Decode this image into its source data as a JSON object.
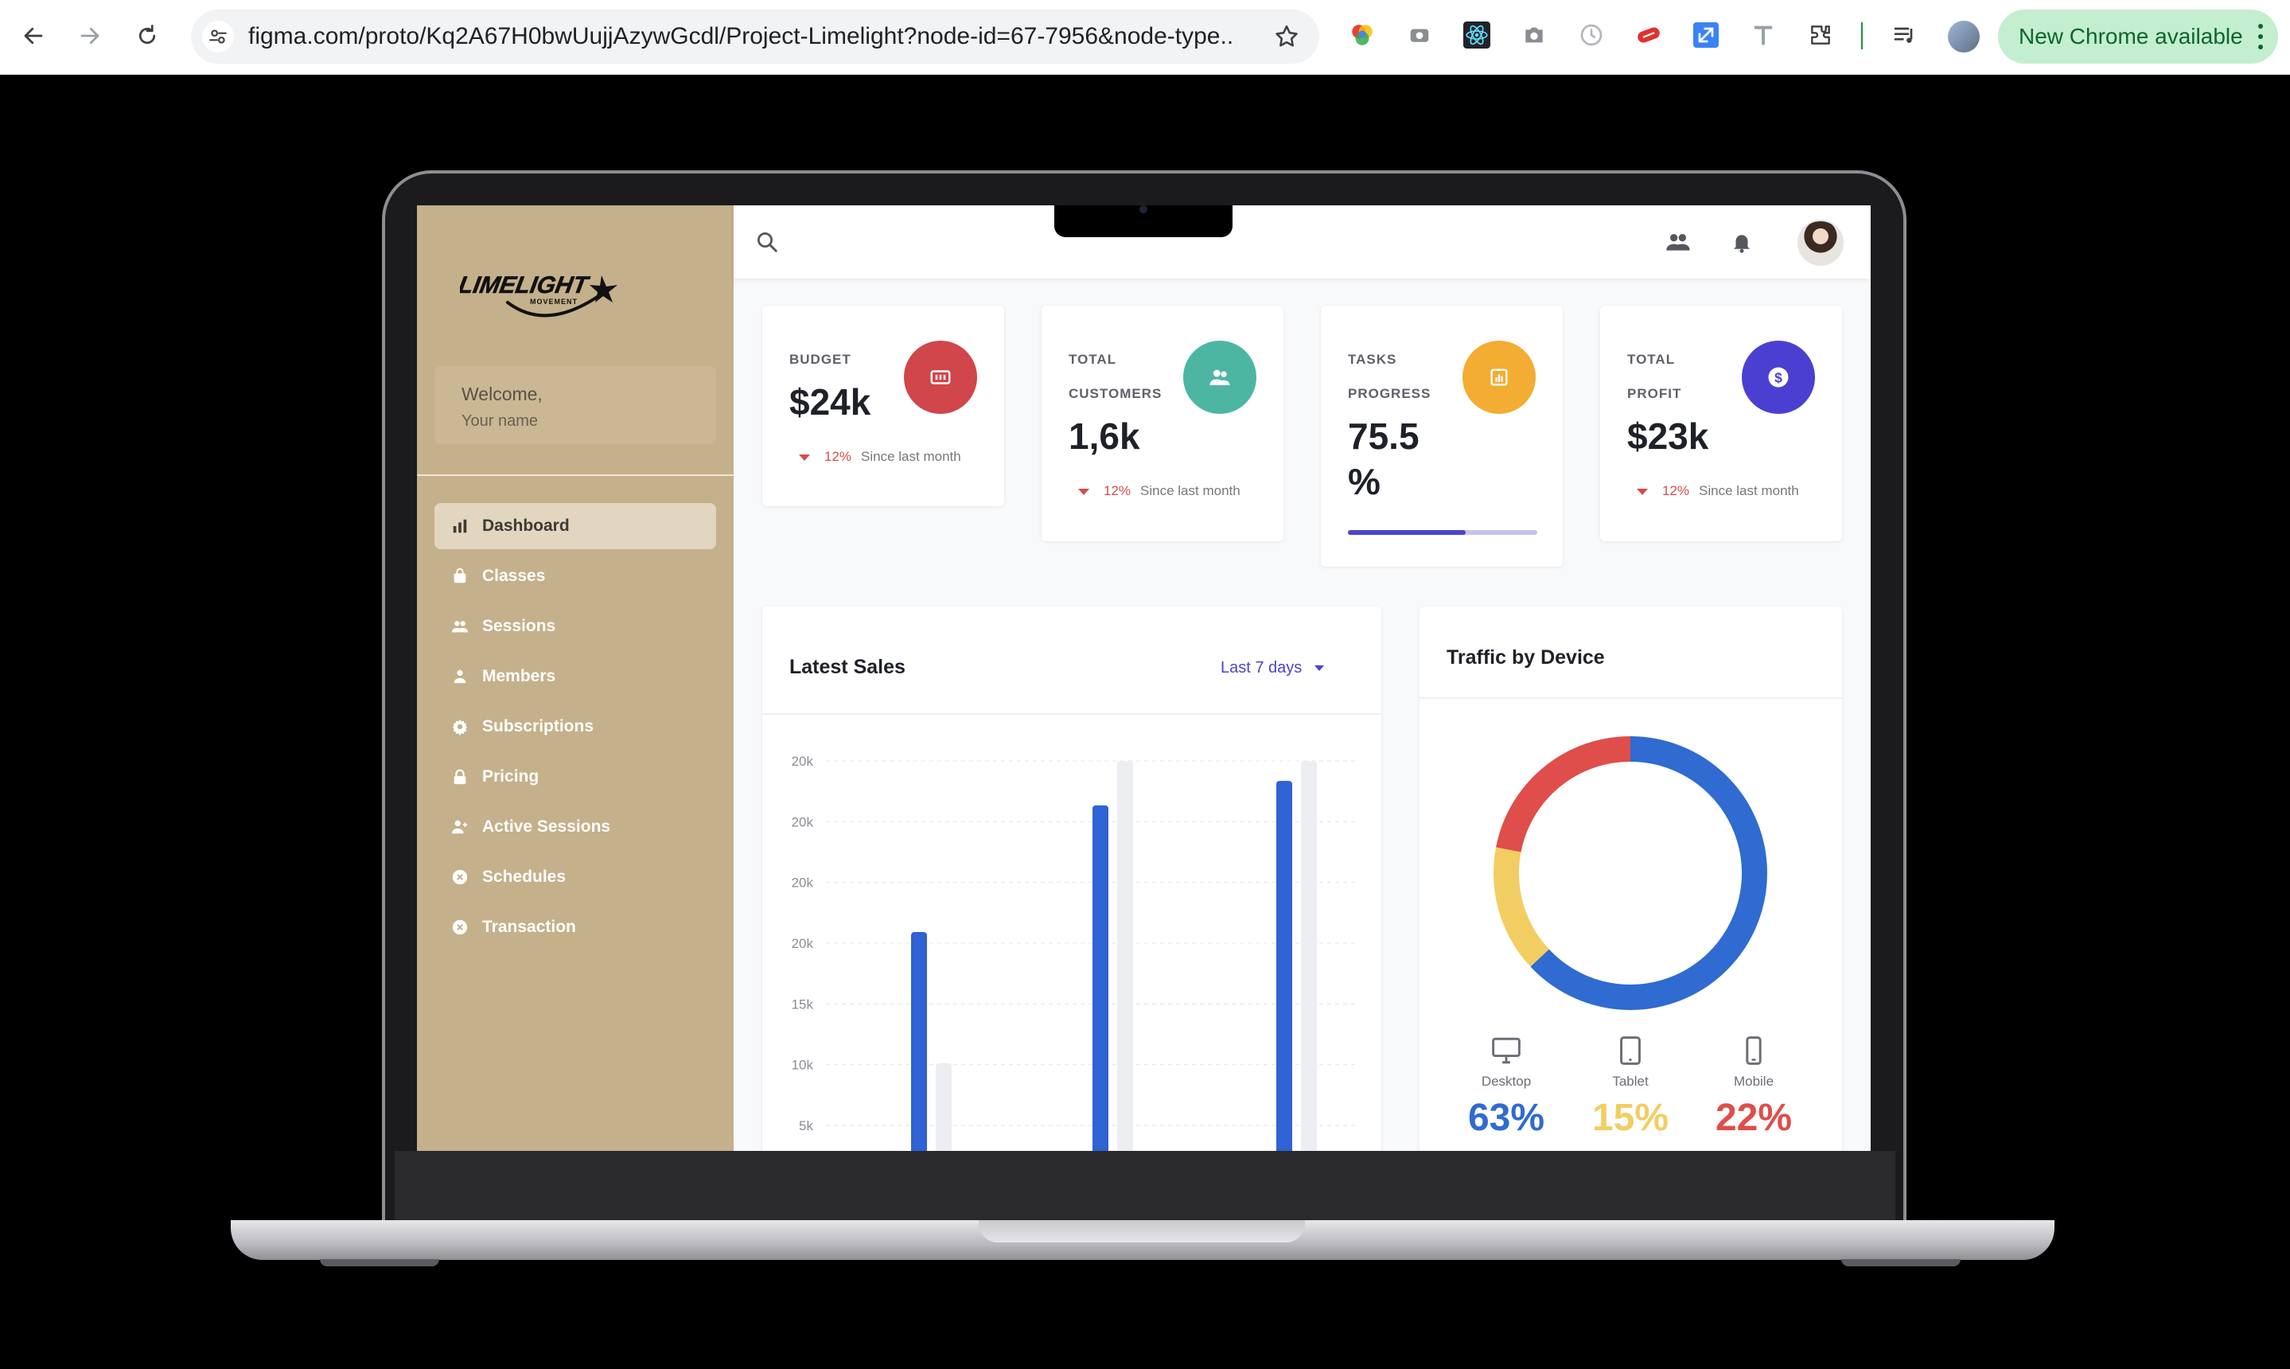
{
  "browser": {
    "url": "figma.com/proto/Kq2A67H0bwUujjAzywGcdl/Project-Limelight?node-id=67-7956&node-type...",
    "update_label": "New Chrome available"
  },
  "sidebar": {
    "brand": "LIMELIGHT",
    "brand_sub": "MOVEMENT",
    "welcome": "Welcome,",
    "user_name": "Your name",
    "items": [
      {
        "label": "Dashboard",
        "icon": "bar-chart-icon",
        "active": true
      },
      {
        "label": "Classes",
        "icon": "bag-icon"
      },
      {
        "label": "Sessions",
        "icon": "people-icon"
      },
      {
        "label": "Members",
        "icon": "person-icon"
      },
      {
        "label": "Subscriptions",
        "icon": "gear-icon"
      },
      {
        "label": "Pricing",
        "icon": "lock-icon"
      },
      {
        "label": "Active Sessions",
        "icon": "person-add-icon"
      },
      {
        "label": "Schedules",
        "icon": "x-circle-icon"
      },
      {
        "label": "Transaction",
        "icon": "x-circle-icon"
      }
    ]
  },
  "stats": [
    {
      "label_line1": "BUDGET",
      "label_line2": "",
      "value": "$24k",
      "trend_pct": "12%",
      "trend_text": "Since last month",
      "color": "#d0464a"
    },
    {
      "label_line1": "TOTAL",
      "label_line2": "CUSTOMERS",
      "value": "1,6k",
      "trend_pct": "12%",
      "trend_text": "Since last month",
      "color": "#4db6a3"
    },
    {
      "label_line1": "TASKS",
      "label_line2": "PROGRESS",
      "value_line1": "75.5",
      "value_line2": "%",
      "progress": 0.62,
      "color": "#f2ad32"
    },
    {
      "label_line1": "TOTAL",
      "label_line2": "PROFIT",
      "value": "$23k",
      "trend_pct": "12%",
      "trend_text": "Since last month",
      "color": "#4b3fd1"
    }
  ],
  "latest_sales": {
    "title": "Latest Sales",
    "range": "Last 7 days"
  },
  "chart_data": {
    "type": "bar",
    "title": "Latest Sales",
    "y_tick_labels": [
      "20k",
      "20k",
      "20k",
      "20k",
      "15k",
      "10k",
      "5k"
    ],
    "series": [
      {
        "color": "#2f62d3",
        "values": [
          13.5,
          19.2,
          20.3
        ]
      },
      {
        "color": "#eceef2",
        "values": [
          7.6,
          21.2,
          21.2
        ]
      }
    ],
    "y_scale": {
      "min": 4.8,
      "max": 21.2
    },
    "grid": true
  },
  "traffic": {
    "title": "Traffic by Device",
    "devices": [
      {
        "name": "Desktop",
        "value": "63%",
        "share": 63,
        "color": "#2f6bd0",
        "icon": "monitor-icon"
      },
      {
        "name": "Tablet",
        "value": "15%",
        "share": 15,
        "color": "#f2ce62",
        "icon": "tablet-icon"
      },
      {
        "name": "Mobile",
        "value": "22%",
        "share": 22,
        "color": "#df4e4a",
        "icon": "phone-icon"
      }
    ]
  }
}
